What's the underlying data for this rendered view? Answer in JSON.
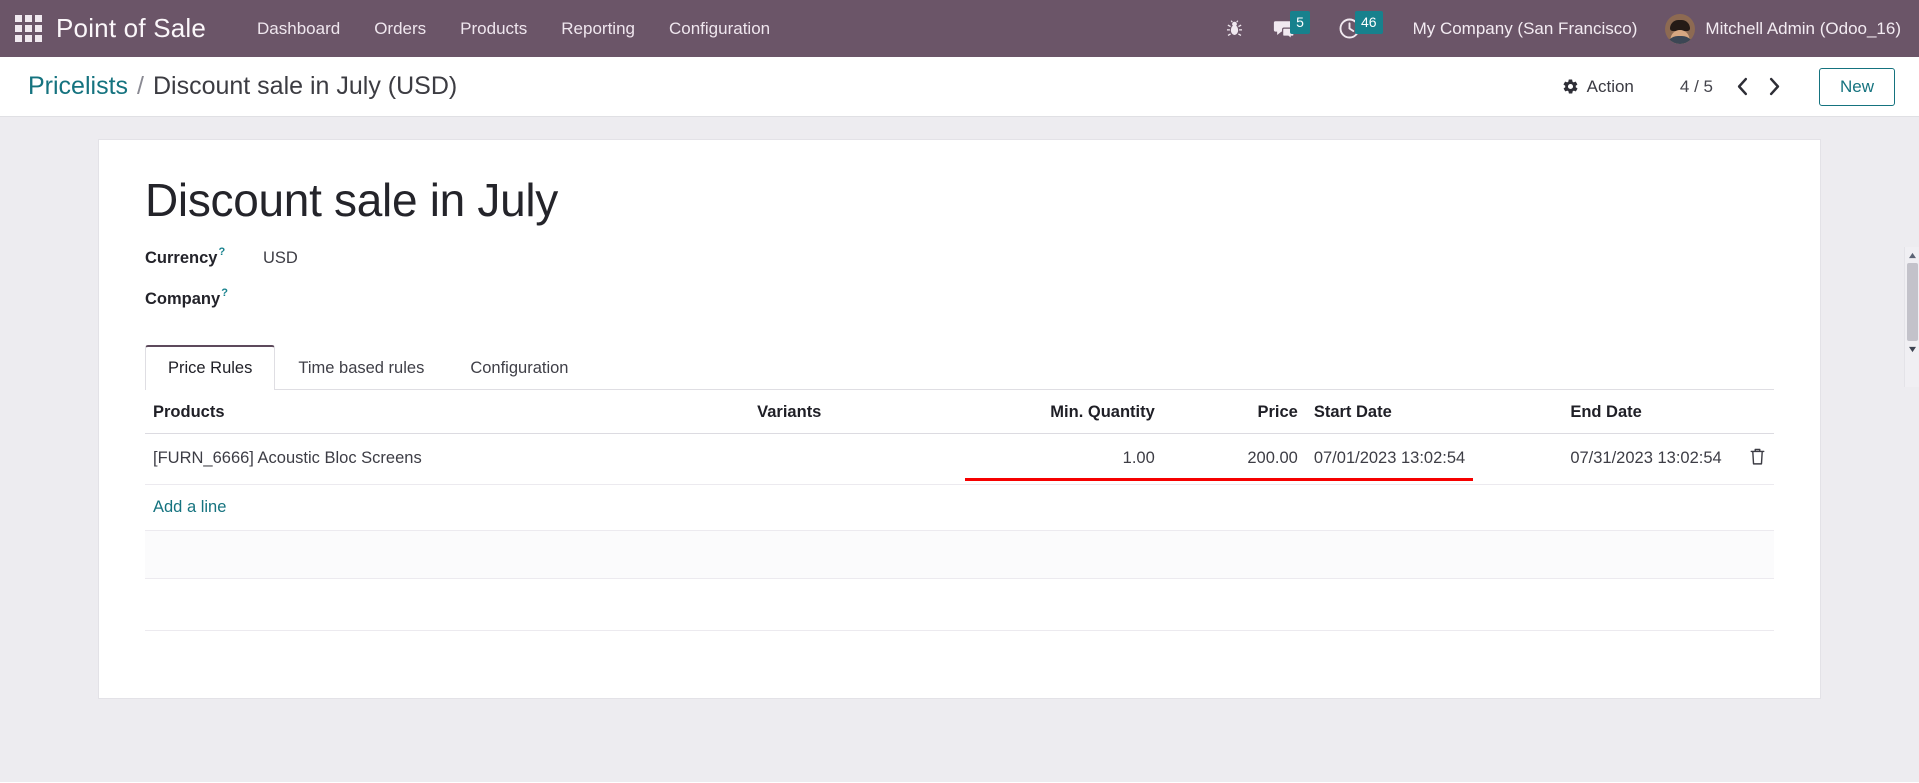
{
  "navbar": {
    "apps_icon": "apps-grid-icon",
    "brand": "Point of Sale",
    "menu": [
      {
        "label": "Dashboard"
      },
      {
        "label": "Orders"
      },
      {
        "label": "Products"
      },
      {
        "label": "Reporting"
      },
      {
        "label": "Configuration"
      }
    ],
    "bug_icon": "bug-icon",
    "messages": {
      "icon": "chat-bubble-icon",
      "count": "5"
    },
    "activities": {
      "icon": "clock-icon",
      "count": "46"
    },
    "company": "My Company (San Francisco)",
    "user": "Mitchell Admin (Odoo_16)",
    "avatar_icon": "user-avatar"
  },
  "control_panel": {
    "breadcrumb_root": "Pricelists",
    "breadcrumb_separator": "/",
    "breadcrumb_current": "Discount sale in July (USD)",
    "action_label": "Action",
    "action_icon": "gear-icon",
    "pager": "4 / 5",
    "prev_icon": "chevron-left-icon",
    "next_icon": "chevron-right-icon",
    "new_label": "New"
  },
  "form": {
    "title": "Discount sale in July",
    "fields": [
      {
        "label": "Currency",
        "tooltip": "?",
        "value": "USD"
      },
      {
        "label": "Company",
        "tooltip": "?",
        "value": ""
      }
    ]
  },
  "notebook": {
    "tabs": [
      {
        "label": "Price Rules",
        "active": true
      },
      {
        "label": "Time based rules",
        "active": false
      },
      {
        "label": "Configuration",
        "active": false
      }
    ]
  },
  "price_rules_table": {
    "columns": [
      {
        "key": "products",
        "label": "Products",
        "align": "left"
      },
      {
        "key": "variants",
        "label": "Variants",
        "align": "left"
      },
      {
        "key": "min_quantity",
        "label": "Min. Quantity",
        "align": "right"
      },
      {
        "key": "price",
        "label": "Price",
        "align": "right"
      },
      {
        "key": "start_date",
        "label": "Start Date",
        "align": "left"
      },
      {
        "key": "end_date",
        "label": "End Date",
        "align": "left"
      }
    ],
    "rows": [
      {
        "products": "[FURN_6666] Acoustic Bloc Screens",
        "variants": "",
        "min_quantity": "1.00",
        "price": "200.00",
        "start_date": "07/01/2023 13:02:54",
        "end_date": "07/31/2023 13:02:54",
        "delete_icon": "trash-icon"
      }
    ],
    "add_line_label": "Add a line"
  },
  "annotation": {
    "underline_color": "#f60000",
    "target": "start-date and end-date cells"
  },
  "colors": {
    "navbar_bg": "#6b5568",
    "accent_teal": "#15737f",
    "badge_bg": "#17818d",
    "page_bg": "#edecf0",
    "tab_active_border": "#5d4a5c"
  }
}
